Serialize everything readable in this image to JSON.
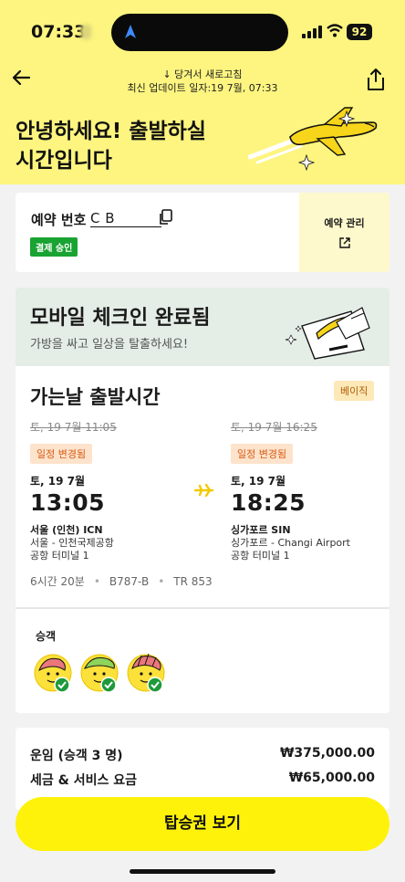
{
  "status_bar": {
    "time": "07:33",
    "battery": "92"
  },
  "header": {
    "refresh_hint": "↓ 당겨서 새로고침",
    "last_updated": "최신 업데이트 일자:19 7월, 07:33",
    "greeting_line1": "안녕하세요! 출발하실",
    "greeting_line2": "시간입니다"
  },
  "booking": {
    "label": "예약 번호",
    "code": "C          B",
    "payment_status": "결제 승인",
    "manage_label": "예약 관리"
  },
  "checkin": {
    "title": "모바일 체크인 완료됨",
    "subtitle": "가방을 싸고 일상을 탈출하세요!"
  },
  "flight": {
    "title": "가는날 출발시간",
    "fare_type": "베이직",
    "departure": {
      "old_time": "토, 19 7월 11:05",
      "changed_badge": "일정 변경됨",
      "date": "토, 19 7월",
      "time": "13:05",
      "city": "서울 (인천) ICN",
      "airport": "서울 - 인천국제공항",
      "terminal": "공항 터미널 1"
    },
    "arrival": {
      "old_time": "토, 19 7월 16:25",
      "changed_badge": "일정 변경됨",
      "date": "토, 19 7월",
      "time": "18:25",
      "city": "싱가포르 SIN",
      "airport": "싱가포르 - Changi Airport",
      "terminal": "공항 터미널 1"
    },
    "duration": "6시간 20분",
    "aircraft": "B787-B",
    "flight_number": "TR 853"
  },
  "passengers": {
    "title": "승객",
    "count": 3
  },
  "fare": {
    "base_label": "운임 (승객 3 명)",
    "base_amount": "₩375,000.00",
    "tax_label": "세금 & 서비스 요금",
    "tax_amount": "₩65,000.00"
  },
  "cta": {
    "label": "탑승권 보기"
  },
  "colors": {
    "brand_yellow": "#fdf57f",
    "cta_yellow": "#fef20a",
    "success": "#19a332",
    "changed": "#d95b12"
  }
}
